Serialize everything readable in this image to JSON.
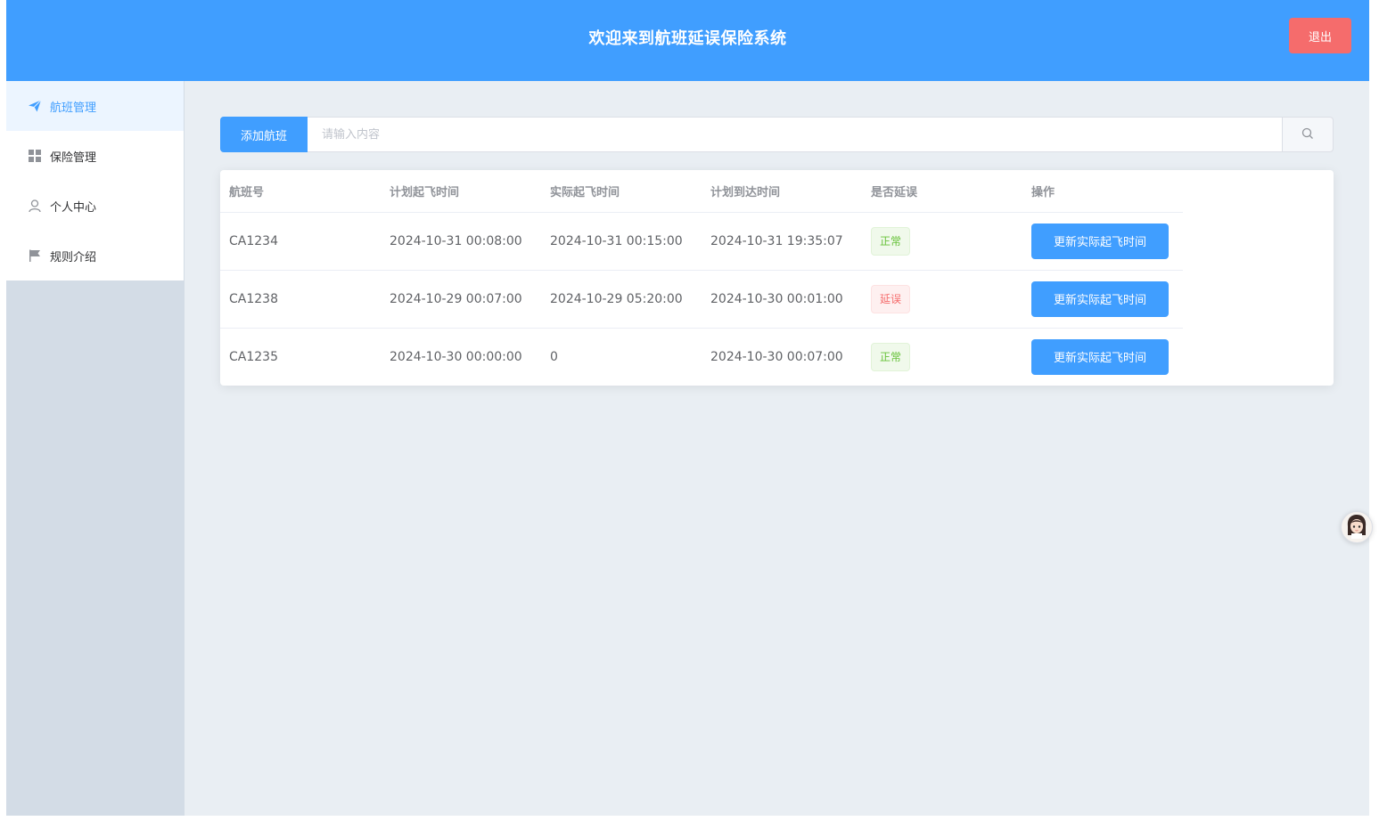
{
  "header": {
    "title": "欢迎来到航班延误保险系统",
    "logout_label": "退出"
  },
  "sidebar": {
    "items": [
      {
        "label": "航班管理",
        "icon": "paper-plane-icon",
        "active": true
      },
      {
        "label": "保险管理",
        "icon": "grid-icon",
        "active": false
      },
      {
        "label": "个人中心",
        "icon": "user-icon",
        "active": false
      },
      {
        "label": "规则介绍",
        "icon": "flag-icon",
        "active": false
      }
    ]
  },
  "toolbar": {
    "add_label": "添加航班",
    "search_placeholder": "请输入内容",
    "search_value": ""
  },
  "table": {
    "headers": [
      "航班号",
      "计划起飞时间",
      "实际起飞时间",
      "计划到达时间",
      "是否延误",
      "操作"
    ],
    "rows": [
      {
        "flight": "CA1234",
        "planned_departure": "2024-10-31 00:08:00",
        "actual_departure": "2024-10-31 00:15:00",
        "planned_arrival": "2024-10-31 19:35:07",
        "status": "正常",
        "status_type": "normal",
        "action": "更新实际起飞时间"
      },
      {
        "flight": "CA1238",
        "planned_departure": "2024-10-29 00:07:00",
        "actual_departure": "2024-10-29 05:20:00",
        "planned_arrival": "2024-10-30 00:01:00",
        "status": "延误",
        "status_type": "delay",
        "action": "更新实际起飞时间"
      },
      {
        "flight": "CA1235",
        "planned_departure": "2024-10-30 00:00:00",
        "actual_departure": "0",
        "planned_arrival": "2024-10-30 00:07:00",
        "status": "正常",
        "status_type": "normal",
        "action": "更新实际起飞时间"
      }
    ]
  },
  "colors": {
    "primary": "#409eff",
    "danger": "#f56c6c",
    "success": "#67c23a",
    "background": "#e9eef3",
    "sidebar": "#d3dce6"
  }
}
